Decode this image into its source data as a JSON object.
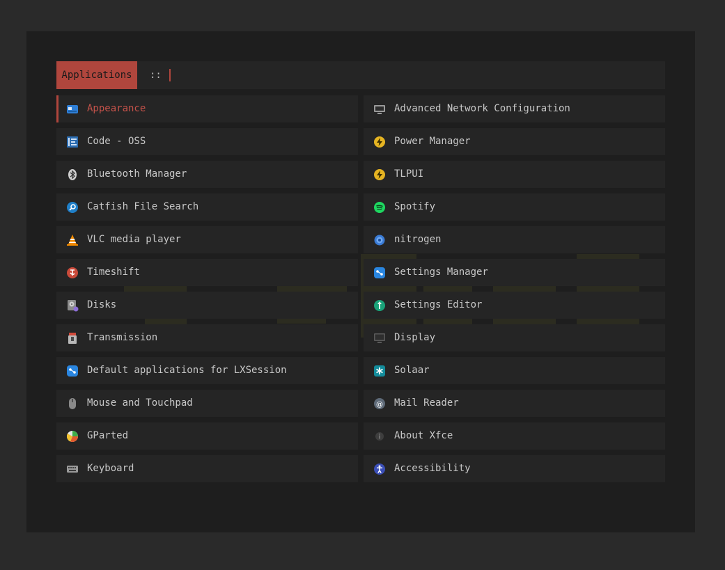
{
  "prompt": {
    "label": "Applications",
    "separator": "::",
    "query": ""
  },
  "accent_color": "#b0463d",
  "selected_index": 0,
  "entries": [
    {
      "label": "Appearance",
      "icon": "appearance-icon"
    },
    {
      "label": "Advanced Network Configuration",
      "icon": "network-icon"
    },
    {
      "label": "Code - OSS",
      "icon": "code-icon"
    },
    {
      "label": "Power Manager",
      "icon": "power-icon"
    },
    {
      "label": "Bluetooth Manager",
      "icon": "bluetooth-icon"
    },
    {
      "label": "TLPUI",
      "icon": "power-icon"
    },
    {
      "label": "Catfish File Search",
      "icon": "search-icon"
    },
    {
      "label": "Spotify",
      "icon": "spotify-icon"
    },
    {
      "label": "VLC media player",
      "icon": "vlc-cone-icon"
    },
    {
      "label": "nitrogen",
      "icon": "nitrogen-icon"
    },
    {
      "label": "Timeshift",
      "icon": "timeshift-icon"
    },
    {
      "label": "Settings Manager",
      "icon": "settings-icon"
    },
    {
      "label": "Disks",
      "icon": "disk-icon"
    },
    {
      "label": "Settings Editor",
      "icon": "settings-editor-icon"
    },
    {
      "label": "Transmission",
      "icon": "transmission-icon"
    },
    {
      "label": "Display",
      "icon": "monitor-icon"
    },
    {
      "label": "Default applications for LXSession",
      "icon": "settings-icon"
    },
    {
      "label": "Solaar",
      "icon": "solaar-icon"
    },
    {
      "label": "Mouse and Touchpad",
      "icon": "mouse-icon"
    },
    {
      "label": "Mail Reader",
      "icon": "mail-icon"
    },
    {
      "label": "GParted",
      "icon": "gparted-icon"
    },
    {
      "label": "About Xfce",
      "icon": "info-icon"
    },
    {
      "label": "Keyboard",
      "icon": "keyboard-icon"
    },
    {
      "label": "Accessibility",
      "icon": "accessibility-icon"
    }
  ]
}
